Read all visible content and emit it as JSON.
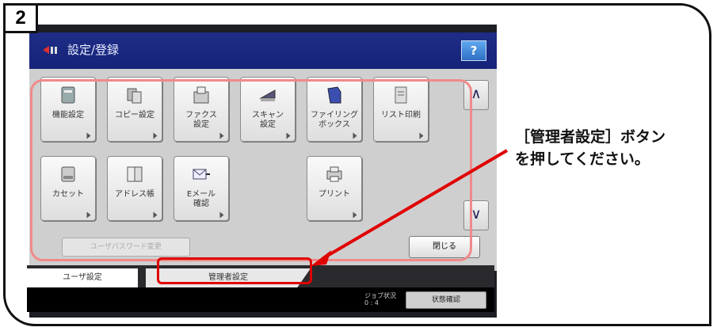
{
  "step_number": "2",
  "window": {
    "title": "設定/登録",
    "help_label": "?"
  },
  "buttons": [
    {
      "label": "機能設定",
      "icon": "settings-doc-icon"
    },
    {
      "label": "コピー設定",
      "icon": "copy-icon"
    },
    {
      "label": "ファクス\n設定",
      "icon": "fax-icon"
    },
    {
      "label": "スキャン\n設定",
      "icon": "scan-icon"
    },
    {
      "label": "ファイリング\nボックス",
      "icon": "filing-box-icon"
    },
    {
      "label": "リスト印刷",
      "icon": "list-print-icon"
    },
    {
      "label": "カセット",
      "icon": "cassette-icon"
    },
    {
      "label": "アドレス帳",
      "icon": "address-book-icon"
    },
    {
      "label": "Eメール\n確認",
      "icon": "email-icon"
    },
    {
      "label": "プリント",
      "icon": "printer-icon"
    }
  ],
  "scroll": {
    "up": "∧",
    "down": "∨"
  },
  "user_password_label": "ユーザパスワード変更",
  "close_label": "閉じる",
  "tabs": {
    "user": "ユーザ設定",
    "admin": "管理者設定"
  },
  "status": {
    "counter": "ジョブ状況\n0 : 4",
    "button": "状態確認"
  },
  "annotation": {
    "line1": "［管理者設定］ボタン",
    "line2": "を押してください。"
  },
  "colors": {
    "titlebar": "#1e2d86",
    "highlight": "#e00000",
    "highlight_soft": "#f08a8a",
    "arrow": "#e00000"
  }
}
